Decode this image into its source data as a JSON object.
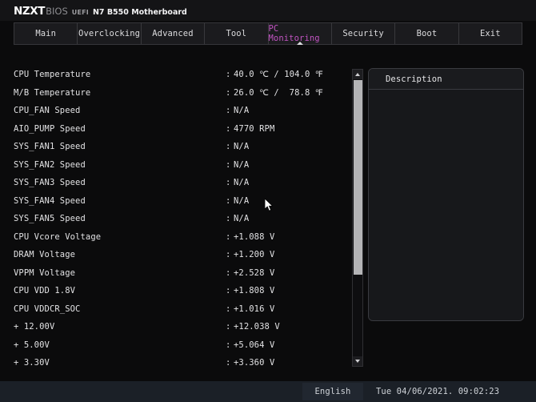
{
  "header": {
    "brand": "NZXT",
    "bios_label": "BIOS",
    "uefi_label": "UEFI",
    "board_name": "N7 B550 Motherboard"
  },
  "tabs": [
    {
      "label": "Main",
      "active": false
    },
    {
      "label": "Overclocking",
      "active": false
    },
    {
      "label": "Advanced",
      "active": false
    },
    {
      "label": "Tool",
      "active": false
    },
    {
      "label": "PC Monitoring",
      "active": true
    },
    {
      "label": "Security",
      "active": false
    },
    {
      "label": "Boot",
      "active": false
    },
    {
      "label": "Exit",
      "active": false
    }
  ],
  "active_tab_color": "#c154c1",
  "monitor_rows": [
    {
      "label": "CPU Temperature",
      "separator": ":",
      "value": "40.0 ℃ / 104.0 ℉"
    },
    {
      "label": "M/B Temperature",
      "separator": ":",
      "value": "26.0 ℃ /  78.8 ℉"
    },
    {
      "label": "CPU_FAN Speed",
      "separator": ":",
      "value": "N/A"
    },
    {
      "label": "AIO_PUMP Speed",
      "separator": ":",
      "value": "4770 RPM"
    },
    {
      "label": "SYS_FAN1 Speed",
      "separator": ":",
      "value": "N/A"
    },
    {
      "label": "SYS_FAN2 Speed",
      "separator": ":",
      "value": "N/A"
    },
    {
      "label": "SYS_FAN3 Speed",
      "separator": ":",
      "value": "N/A"
    },
    {
      "label": "SYS_FAN4 Speed",
      "separator": ":",
      "value": "N/A"
    },
    {
      "label": "SYS_FAN5 Speed",
      "separator": ":",
      "value": "N/A"
    },
    {
      "label": "CPU Vcore Voltage",
      "separator": ":",
      "value": "+1.088 V"
    },
    {
      "label": "DRAM Voltage",
      "separator": ":",
      "value": "+1.200 V"
    },
    {
      "label": "VPPM Voltage",
      "separator": ":",
      "value": "+2.528 V"
    },
    {
      "label": "CPU VDD 1.8V",
      "separator": ":",
      "value": "+1.808 V"
    },
    {
      "label": "CPU VDDCR_SOC",
      "separator": ":",
      "value": "+1.016 V"
    },
    {
      "label": "+ 12.00V",
      "separator": ":",
      "value": "+12.038 V"
    },
    {
      "label": "+ 5.00V",
      "separator": ":",
      "value": "+5.064 V"
    },
    {
      "label": "+ 3.30V",
      "separator": ":",
      "value": "+3.360 V"
    }
  ],
  "scrollbar": {
    "up_icon": "triangle-up-icon",
    "down_icon": "triangle-down-icon"
  },
  "description": {
    "title": "Description",
    "body": ""
  },
  "footer": {
    "language": "English",
    "datetime": "Tue 04/06/2021. 09:02:23"
  }
}
